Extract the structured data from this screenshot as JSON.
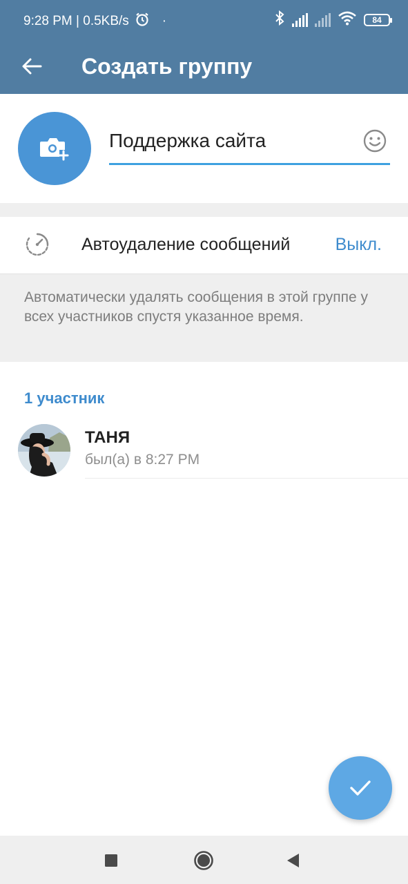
{
  "status_bar": {
    "time_speed": "9:28 PM | 0.5KB/s",
    "dot": "·",
    "battery": "84"
  },
  "app_bar": {
    "title": "Создать группу",
    "back_icon": "arrow-left-icon"
  },
  "group": {
    "name_value": "Поддержка сайта",
    "avatar_icon": "camera-add-icon",
    "emoji_icon": "smile-icon"
  },
  "autodelete": {
    "label": "Автоудаление сообщений",
    "value": "Выкл.",
    "icon": "timer-icon",
    "hint": "Автоматически удалять сообщения в этой группе у всех участников спустя указанное время."
  },
  "members": {
    "header": "1 участник",
    "items": [
      {
        "name": "ТАНЯ",
        "status": "был(а) в 8:27 PM"
      }
    ]
  },
  "fab": {
    "icon": "check-icon"
  },
  "nav": {
    "icons": [
      "square-icon",
      "circle-icon",
      "triangle-back-icon"
    ]
  },
  "colors": {
    "accent_bar": "#517da2",
    "accent_blue": "#3e8bcd",
    "fab": "#5ea8e4"
  }
}
